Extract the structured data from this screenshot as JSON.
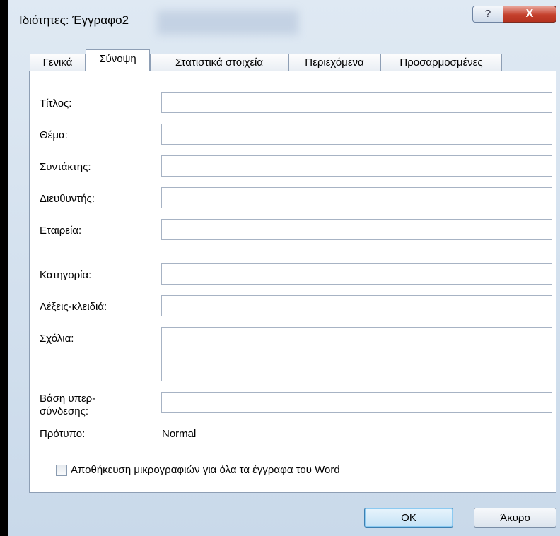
{
  "window": {
    "title": "Ιδιότητες: Έγγραφο2",
    "help_glyph": "?",
    "close_glyph": "X"
  },
  "tabs": [
    {
      "label": "Γενικά",
      "active": false
    },
    {
      "label": "Σύνοψη",
      "active": true
    },
    {
      "label": "Στατιστικά στοιχεία",
      "active": false
    },
    {
      "label": "Περιεχόμενα",
      "active": false
    },
    {
      "label": "Προσαρμοσμένες",
      "active": false
    }
  ],
  "fields": {
    "title_label": "Τίτλος:",
    "title_value": "",
    "subject_label": "Θέμα:",
    "subject_value": "",
    "author_label": "Συντάκτης:",
    "author_value": "",
    "manager_label": "Διευθυντής:",
    "manager_value": "",
    "company_label": "Εταιρεία:",
    "company_value": "",
    "category_label": "Κατηγορία:",
    "category_value": "",
    "keywords_label": "Λέξεις-κλειδιά:",
    "keywords_value": "",
    "comments_label": "Σχόλια:",
    "comments_value": "",
    "hyperlink_label_line1": "Βάση υπερ-",
    "hyperlink_label_line2": "σύνδεσης:",
    "hyperlink_value": "",
    "template_label": "Πρότυπο:",
    "template_value": "Normal"
  },
  "checkbox": {
    "label": "Αποθήκευση μικρογραφιών για όλα τα έγγραφα του Word",
    "checked": false
  },
  "buttons": {
    "ok_label": "OK",
    "cancel_label": "Άκυρο"
  },
  "colors": {
    "close_button": "#c4402c",
    "ok_button_border": "#3c7fb1",
    "dialog_background": "#dfe9f3"
  }
}
